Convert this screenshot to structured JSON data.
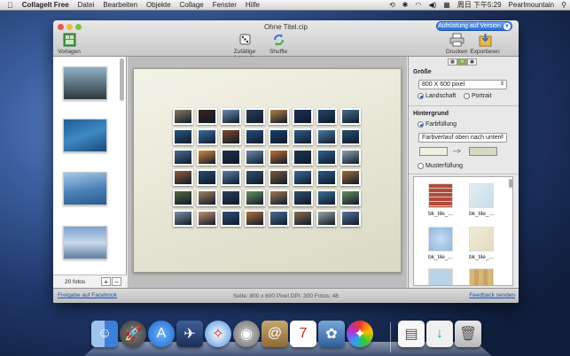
{
  "menubar": {
    "app": "Collagelt Free",
    "items": [
      "Datei",
      "Bearbeiten",
      "Objekte",
      "Collage",
      "Fenster",
      "Hilfe"
    ],
    "datetime": "周日 下午5:29",
    "user": "Pearlmountain"
  },
  "window": {
    "title": "Ohne Titel.cip",
    "upgrade_label": "Aufrüstung auf Version"
  },
  "toolbar": {
    "templates": "Vorlagen",
    "random_layouts": "Zufällige Layouts",
    "shuffle": "Shuffle",
    "print": "Drucken",
    "export": "Exportieren"
  },
  "sidebar": {
    "photo_count": "20 fotos",
    "add": "+",
    "remove": "−"
  },
  "right_panel": {
    "size_heading": "Größe",
    "size_value": "800 X 600 pixel",
    "landscape": "Landschaft",
    "portrait": "Portrait",
    "background_heading": "Hintergrund",
    "fill": "Farbfüllung",
    "gradient_value": "Farbverlauf oben nach unten",
    "arrow": "-->",
    "pattern_fill": "Musterfüllung",
    "tiles": [
      "bk_tile_...",
      "bk_tile_...",
      "bk_tile_...",
      "bk_tile_..."
    ]
  },
  "status": {
    "share": "Freigabe auf Facebook",
    "info": "Seite: 800 x 600 Pixel  DPI: 300 Fotos: 48",
    "feedback": "Feedback senden"
  },
  "colors": {
    "upgrade": "#2c6bd0",
    "link": "#2255aa",
    "canvas_page": "#e8e7d6"
  },
  "photo_colors": [
    "#8a7a62",
    "#3a2418",
    "#6c8ab0",
    "#2e3d58",
    "#b08248",
    "#1b3056",
    "#20456a",
    "#4a6f8c",
    "#2a5780",
    "#3b6fa0",
    "#7a4a2a",
    "#264d80",
    "#1d3f6b",
    "#325b88",
    "#4c7aa6",
    "#2b4d70",
    "#4d6d8e",
    "#d38b3a",
    "#1f2f4a",
    "#6d8bb0",
    "#c07038",
    "#1e3552",
    "#2e6290",
    "#8aa0b4",
    "#8e5d3a",
    "#2a4b75",
    "#5a7ea8",
    "#33506f",
    "#7c5a3e",
    "#3a6b98",
    "#2d5a8a",
    "#a06b3c",
    "#56683e",
    "#a08060",
    "#2b3e5c",
    "#6a8f60",
    "#9d7b55",
    "#2f4d6e",
    "#3e6d9a",
    "#6b8a5e",
    "#7d8fa0",
    "#c29070",
    "#324e78",
    "#b07040",
    "#4e6d90",
    "#8a6e50",
    "#9aa5a0",
    "#5b7493"
  ]
}
